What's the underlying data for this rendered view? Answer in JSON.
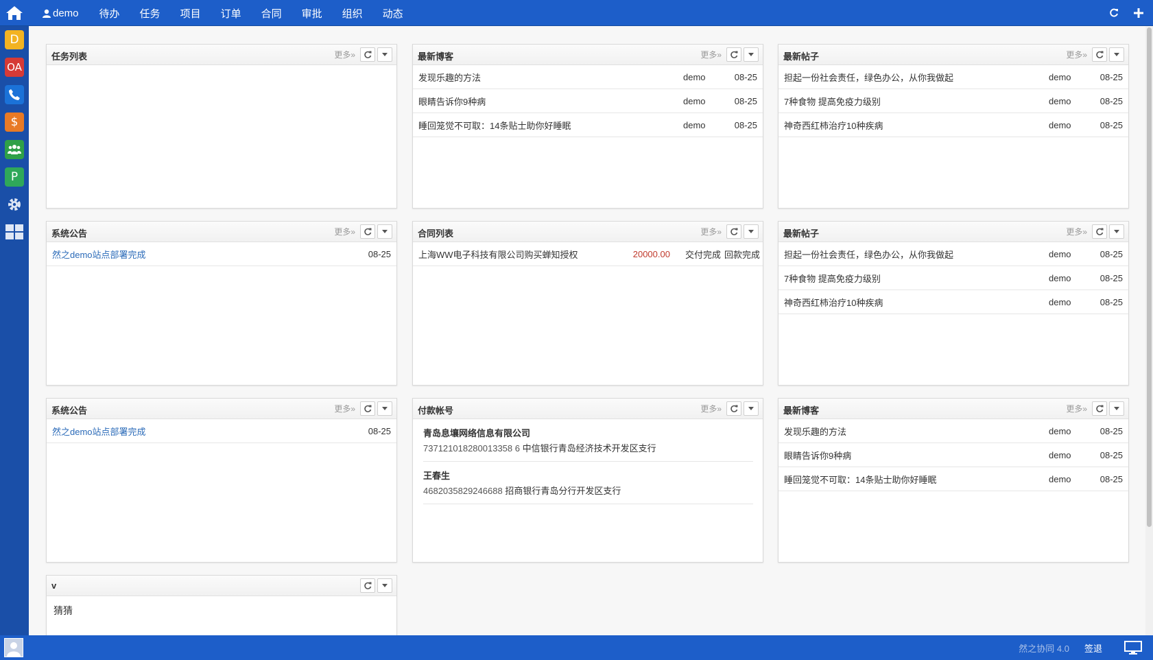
{
  "topbar": {
    "user": "demo",
    "nav": [
      "待办",
      "任务",
      "项目",
      "订单",
      "合同",
      "审批",
      "组织",
      "动态"
    ]
  },
  "sidebar": {
    "items": [
      {
        "label": "D",
        "color": "#f3b321",
        "icon": "docs-icon"
      },
      {
        "label": "OA",
        "color": "#d63a36",
        "icon": "oa-icon"
      },
      {
        "label": "",
        "color": "#1b72d8",
        "icon": "phone-icon"
      },
      {
        "label": "$",
        "color": "#e87a25",
        "icon": "dollar-icon"
      },
      {
        "label": "",
        "color": "#2fa048",
        "icon": "users-icon"
      },
      {
        "label": "P",
        "color": "#2fa85a",
        "icon": "project-icon"
      },
      {
        "label": "",
        "color": "#5a7db8",
        "icon": "gear-icon"
      },
      {
        "label": "",
        "color": "#5a7db8",
        "icon": "grid-icon"
      }
    ]
  },
  "bottombar": {
    "version": "然之协同 4.0",
    "logout": "签退"
  },
  "more_label": "更多»",
  "panels": {
    "tasks": {
      "title": "任务列表"
    },
    "blog1": {
      "title": "最新博客",
      "rows": [
        {
          "title": "发现乐趣的方法",
          "user": "demo",
          "date": "08-25"
        },
        {
          "title": "眼睛告诉你9种病",
          "user": "demo",
          "date": "08-25"
        },
        {
          "title": "睡回笼觉不可取：14条贴士助你好睡眠",
          "user": "demo",
          "date": "08-25"
        }
      ]
    },
    "posts1": {
      "title": "最新帖子",
      "rows": [
        {
          "title": "担起一份社会责任，绿色办公，从你我做起",
          "user": "demo",
          "date": "08-25"
        },
        {
          "title": "7种食物 提高免疫力级别",
          "user": "demo",
          "date": "08-25"
        },
        {
          "title": "神奇西红柿治疗10种疾病",
          "user": "demo",
          "date": "08-25"
        }
      ]
    },
    "notice1": {
      "title": "系统公告",
      "rows": [
        {
          "title": "然之demo站点部署完成",
          "date": "08-25"
        }
      ]
    },
    "contracts": {
      "title": "合同列表",
      "rows": [
        {
          "title": "上海WW电子科技有限公司购买蝉知授权",
          "amount": "20000.00",
          "delivery": "交付完成",
          "payment": "回款完成"
        }
      ]
    },
    "posts2": {
      "title": "最新帖子",
      "rows": [
        {
          "title": "担起一份社会责任，绿色办公，从你我做起",
          "user": "demo",
          "date": "08-25"
        },
        {
          "title": "7种食物 提高免疫力级别",
          "user": "demo",
          "date": "08-25"
        },
        {
          "title": "神奇西红柿治疗10种疾病",
          "user": "demo",
          "date": "08-25"
        }
      ]
    },
    "notice2": {
      "title": "系统公告",
      "rows": [
        {
          "title": "然之demo站点部署完成",
          "date": "08-25"
        }
      ]
    },
    "accounts": {
      "title": "付款帐号",
      "items": [
        {
          "name": "青岛息壤网络信息有限公司",
          "number": "737121018280013358 6",
          "bank": "中信银行青岛经济技术开发区支行"
        },
        {
          "name": "王春生",
          "number": "4682035829246688",
          "bank": "招商银行青岛分行开发区支行"
        }
      ]
    },
    "blog2": {
      "title": "最新博客",
      "rows": [
        {
          "title": "发现乐趣的方法",
          "user": "demo",
          "date": "08-25"
        },
        {
          "title": "眼睛告诉你9种病",
          "user": "demo",
          "date": "08-25"
        },
        {
          "title": "睡回笼觉不可取：14条贴士助你好睡眠",
          "user": "demo",
          "date": "08-25"
        }
      ]
    },
    "note": {
      "title": "v",
      "content": "猜猜"
    }
  }
}
